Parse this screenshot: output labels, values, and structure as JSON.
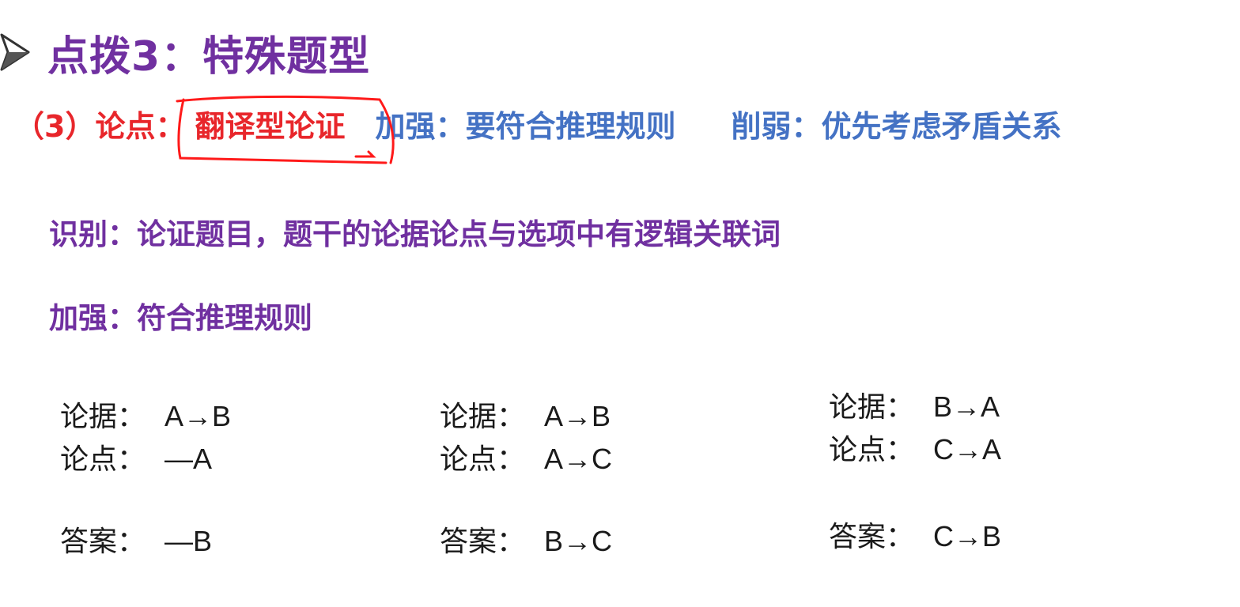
{
  "title": "点拨3：特殊题型",
  "subtitle": {
    "label": "（3）论点：",
    "highlight": "翻译型论证",
    "strengthen": "加强：要符合推理规则",
    "weaken": "削弱：优先考虑矛盾关系"
  },
  "paragraphs": {
    "identify": "识别：论证题目，题干的论据论点与选项中有逻辑关联词",
    "strengthen": "加强：符合推理规则"
  },
  "examples": [
    {
      "evidence_label": "论据：",
      "evidence": "A→B",
      "claim_label": "论点：",
      "claim": "—A",
      "answer_label": "答案：",
      "answer": "—B"
    },
    {
      "evidence_label": "论据：",
      "evidence": "A→B",
      "claim_label": "论点：",
      "claim": "A→C",
      "answer_label": "答案：",
      "answer": "B→C"
    },
    {
      "evidence_label": "论据：",
      "evidence": "B→A",
      "claim_label": "论点：",
      "claim": "C→A",
      "answer_label": "答案：",
      "answer": "C→B"
    }
  ],
  "colors": {
    "title": "#7030a0",
    "label_red": "#e8262b",
    "blue": "#4472c4",
    "annotation": "#ff1a1a"
  },
  "icons": {
    "title_bullet": "arrowhead-bullet-icon",
    "annotation": "hand-drawn-box"
  }
}
